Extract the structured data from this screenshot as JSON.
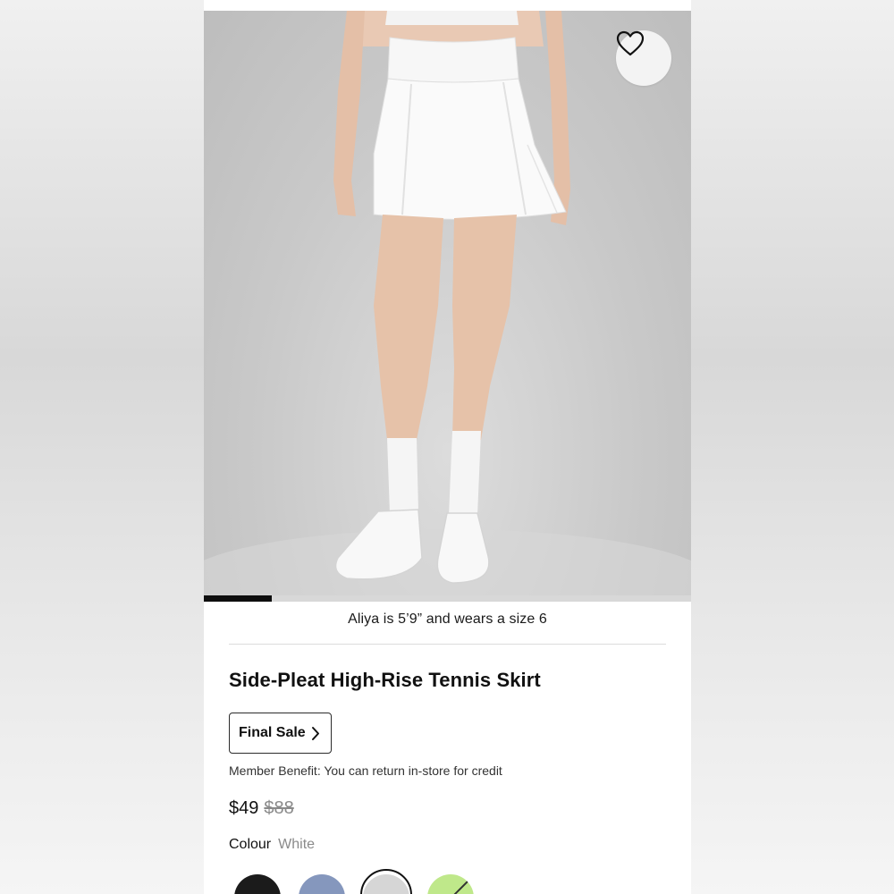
{
  "product": {
    "model_note": "Aliya is 5’9” and wears a size 6",
    "title": "Side-Pleat High-Rise Tennis Skirt",
    "final_sale_label": "Final Sale",
    "member_benefit": "Member Benefit: You can return in-store for credit",
    "price": "$49",
    "original_price": "$88",
    "colour_label": "Colour",
    "colour_value": "White"
  },
  "gallery": {
    "progress": 0.14,
    "wishlist_icon": "heart-icon"
  },
  "swatches": [
    {
      "name": "black",
      "color": "#1b1b1b"
    },
    {
      "name": "blue",
      "color": "#8597bd"
    },
    {
      "name": "white",
      "color": "#d6d6d6",
      "selected": true
    },
    {
      "name": "green",
      "color": "#bfe88a"
    }
  ],
  "colors": {
    "text": "#111111",
    "muted": "#8a8a8a",
    "border": "#2b2b2b"
  }
}
